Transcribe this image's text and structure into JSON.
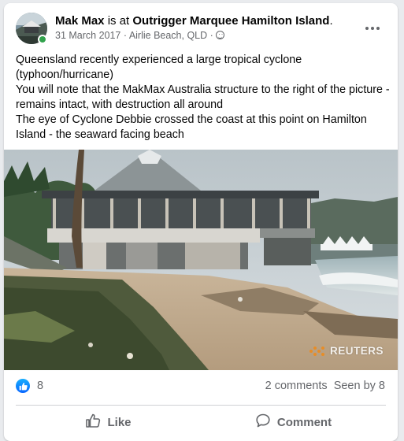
{
  "post": {
    "author": "Mak Max",
    "connector": " is at ",
    "place": "Outrigger Marquee Hamilton Island",
    "place_suffix": ".",
    "date": "31 March 2017",
    "location": "Airlie Beach, QLD",
    "separator": " · ",
    "audience_icon": "globe-icon",
    "more_icon": "more-options-icon",
    "text_lines": [
      "Queensland recently experienced a large tropical cyclone (typhoon/hurricane)",
      "You will note that the MakMax Australia structure to the right of the picture - remains intact, with destruction all around",
      "The eye of Cyclone Debbie crossed the coast at this point on Hamilton Island - the seaward facing beach"
    ],
    "photo_watermark": "REUTERS"
  },
  "stats": {
    "like_count": "8",
    "comments": "2 comments",
    "seen_by": "Seen by 8"
  },
  "actions": {
    "like": "Like",
    "comment": "Comment"
  },
  "colors": {
    "accent": "#0866ff",
    "online": "#31a24c",
    "secondary_text": "#65676b"
  }
}
